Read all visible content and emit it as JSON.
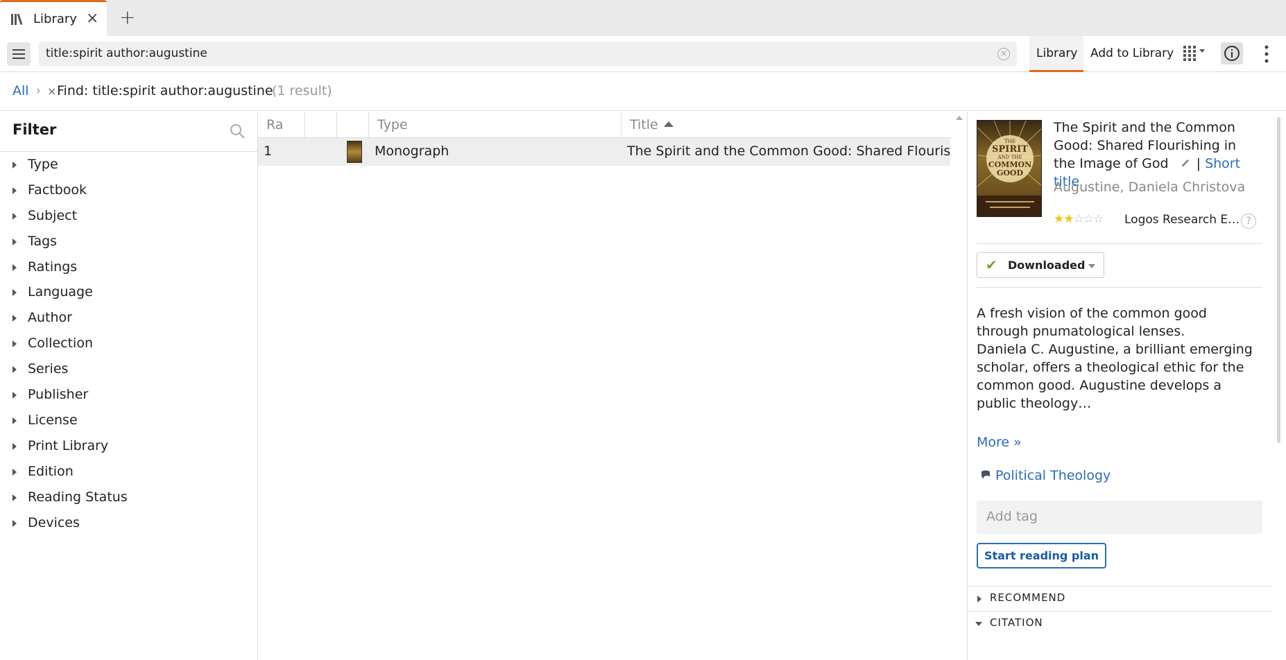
{
  "tab": {
    "label": "Library"
  },
  "toolbar": {
    "search_value": "title:spirit author:augustine",
    "library_label": "Library",
    "add_label": "Add to Library"
  },
  "breadcrumb": {
    "all": "All",
    "separator": "›",
    "remove": "×",
    "find": "Find: title:spirit author:augustine",
    "count": "(1 result)"
  },
  "filter": {
    "title": "Filter",
    "items": [
      "Type",
      "Factbook",
      "Subject",
      "Tags",
      "Ratings",
      "Language",
      "Author",
      "Collection",
      "Series",
      "Publisher",
      "License",
      "Print Library",
      "Edition",
      "Reading Status",
      "Devices"
    ]
  },
  "table": {
    "columns": [
      "Ra",
      "",
      "",
      "Type",
      "Title"
    ],
    "rows": [
      {
        "rank": "1",
        "type": "Monograph",
        "title": "The Spirit and the Common Good: Shared Flourishing in the Image of God"
      }
    ]
  },
  "detail": {
    "title": "The Spirit and the Common Good: Shared Flourishing in the Image of God",
    "short_title": "Short title",
    "pipe": "|",
    "author": "Augustine, Daniela Christova",
    "rating": 2,
    "rating_max": 5,
    "publisher": "Logos Research E…",
    "help": "?",
    "download_status": "Downloaded",
    "description_1": "A fresh vision of the common good through pnumatological lenses.",
    "description_2": "Daniela C. Augustine, a brilliant emerging scholar, offers a theological ethic for the common good. Augustine develops a public theology…",
    "more": "More »",
    "collection": "Political Theology",
    "add_tag_placeholder": "Add tag",
    "reading_plan": "Start reading plan",
    "sections": [
      "RECOMMEND",
      "CITATION"
    ]
  },
  "cover": {
    "line1": "THE",
    "line2": "SPIRIT",
    "line3": "AND THE",
    "line4": "COMMON",
    "line5": "GOOD"
  },
  "colors": {
    "accent": "#e06a1c",
    "link": "#2b6cb8",
    "star": "#f0c419",
    "check": "#6aa52d"
  },
  "icons": [
    "library-icon",
    "close-icon",
    "plus-icon",
    "menu-icon",
    "clear-icon",
    "grid-view-icon",
    "info-icon",
    "more-vertical-icon",
    "search-icon",
    "edit-icon",
    "check-icon",
    "collection-icon"
  ]
}
